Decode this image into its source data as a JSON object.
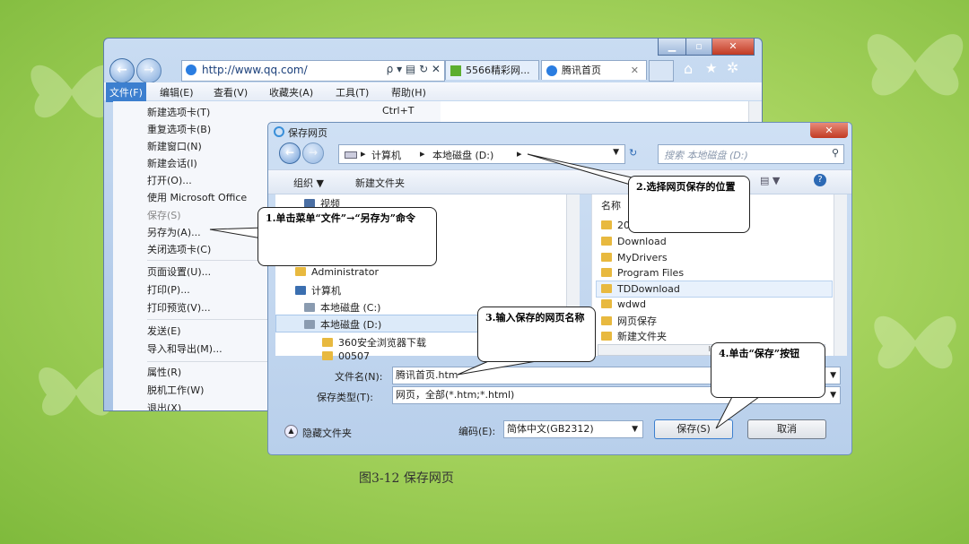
{
  "ie": {
    "address": "http://www.qq.com/",
    "tabs": [
      "5566精彩网...",
      "腾讯首页"
    ],
    "menubar": [
      "文件(F)",
      "编辑(E)",
      "查看(V)",
      "收藏夹(A)",
      "工具(T)",
      "帮助(H)"
    ],
    "file_menu": [
      {
        "label": "新建选项卡(T)",
        "shortcut": "Ctrl+T"
      },
      {
        "label": "重复选项卡(B)",
        "shortcut": ""
      },
      {
        "label": "新建窗口(N)",
        "shortcut": ""
      },
      {
        "label": "新建会话(I)",
        "shortcut": ""
      },
      {
        "label": "打开(O)...",
        "shortcut": ""
      },
      {
        "label": "使用 Microsoft Office",
        "shortcut": ""
      },
      {
        "label": "保存(S)",
        "shortcut": ""
      },
      {
        "label": "另存为(A)...",
        "shortcut": ""
      },
      {
        "label": "关闭选项卡(C)",
        "shortcut": ""
      },
      {
        "label": "页面设置(U)...",
        "shortcut": ""
      },
      {
        "label": "打印(P)...",
        "shortcut": ""
      },
      {
        "label": "打印预览(V)...",
        "shortcut": ""
      },
      {
        "label": "发送(E)",
        "shortcut": ""
      },
      {
        "label": "导入和导出(M)...",
        "shortcut": ""
      },
      {
        "label": "属性(R)",
        "shortcut": ""
      },
      {
        "label": "脱机工作(W)",
        "shortcut": ""
      },
      {
        "label": "退出(X)",
        "shortcut": ""
      }
    ]
  },
  "dialog": {
    "title": "保存网页",
    "breadcrumb": [
      "计算机",
      "本地磁盘 (D:)"
    ],
    "search_placeholder": "搜索 本地磁盘 (D:)",
    "organize": "组织 ▼",
    "new_folder": "新建文件夹",
    "tree": [
      "视频",
      "Administrator",
      "计算机",
      "本地磁盘 (C:)",
      "本地磁盘 (D:)",
      "360安全浏览器下载",
      "00507"
    ],
    "column_name": "名称",
    "files": [
      "20",
      "Download",
      "MyDrivers",
      "Program Files",
      "TDDownload",
      "wdwd",
      "网页保存",
      "新建文件夹"
    ],
    "filename_label": "文件名(N):",
    "filename_value": "腾讯首页.htm",
    "filetype_label": "保存类型(T):",
    "filetype_value": "网页，全部(*.htm;*.html)",
    "hide_folders": "隐藏文件夹",
    "encoding_label": "编码(E):",
    "encoding_value": "简体中文(GB2312)",
    "save": "保存(S)",
    "cancel": "取消",
    "scroll_mark": "III"
  },
  "callouts": {
    "c1": "1.单击菜单“文件”→“另存为”命令",
    "c2": "2.选择网页保存的位置",
    "c3": "3.输入保存的网页名称",
    "c4": "4.单击“保存”按钮"
  },
  "caption": "图3-12 保存网页"
}
